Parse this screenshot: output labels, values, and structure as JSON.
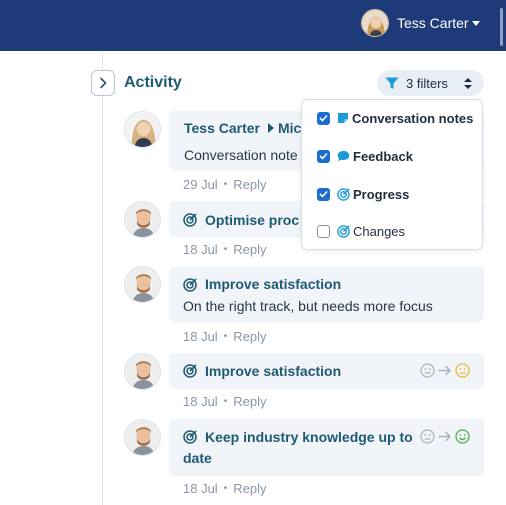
{
  "header": {
    "user_name": "Tess Carter"
  },
  "activity": {
    "title": "Activity"
  },
  "filters": {
    "label": "3 filters",
    "options": [
      {
        "label": "Conversation notes",
        "checked": true,
        "icon": "note-icon"
      },
      {
        "label": "Feedback",
        "checked": true,
        "icon": "speech-bubble-icon"
      },
      {
        "label": "Progress",
        "checked": true,
        "icon": "goal-target-icon"
      },
      {
        "label": "Changes",
        "checked": false,
        "icon": "goal-target-icon"
      }
    ]
  },
  "feed": [
    {
      "author": "Tess Carter",
      "recipient": "Mic",
      "body": "Conversation note",
      "date": "29 Jul",
      "reply": "Reply"
    },
    {
      "title": "Optimise proc",
      "date": "18 Jul",
      "reply": "Reply"
    },
    {
      "title": "Improve satisfaction",
      "body": "On the right track, but needs more focus",
      "date": "18 Jul",
      "reply": "Reply"
    },
    {
      "title": "Improve satisfaction",
      "date": "18 Jul",
      "reply": "Reply",
      "status_from": "neutral",
      "status_to": "okay",
      "status_to_color": "#e8b931"
    },
    {
      "title_line1": "Keep industry knowledge up to",
      "title_line2": "date",
      "date": "18 Jul",
      "reply": "Reply",
      "status_from": "neutral",
      "status_to": "good",
      "status_to_color": "#4caf50"
    }
  ],
  "colors": {
    "header_bg": "#1e3a78",
    "accent": "#1a6fd0",
    "title": "#1f5a73",
    "card_bg": "#f1f4f8"
  }
}
